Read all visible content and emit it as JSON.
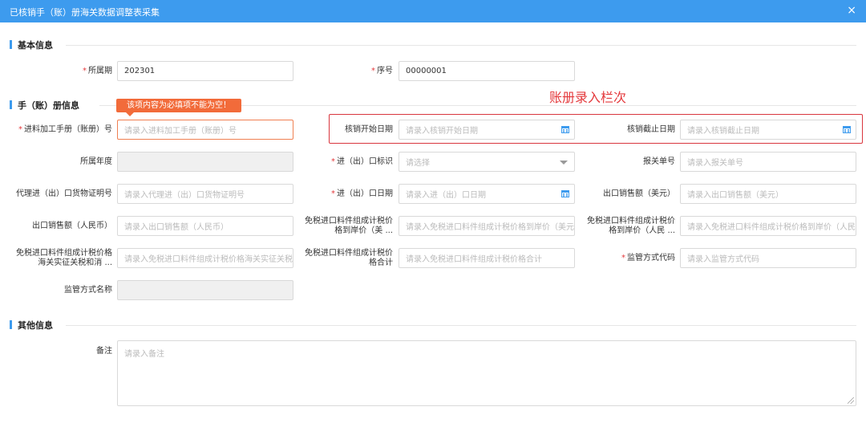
{
  "window": {
    "title": "已核销手（账）册海关数据调整表采集",
    "close_glyph": "×"
  },
  "sections": {
    "basic": "基本信息",
    "manual": "手（账）册信息",
    "other": "其他信息"
  },
  "fields": {
    "period": {
      "label": "所属期",
      "required": true,
      "value": "202301"
    },
    "seq": {
      "label": "序号",
      "required": true,
      "value": "00000001"
    },
    "manual_no": {
      "label": "进料加工手册（账册）号",
      "required": true,
      "placeholder": "请录入进料加工手册（账册）号"
    },
    "start_date": {
      "label": "核销开始日期",
      "placeholder": "请录入核销开始日期"
    },
    "end_date": {
      "label": "核销截止日期",
      "placeholder": "请录入核销截止日期"
    },
    "year": {
      "label": "所属年度"
    },
    "io_flag": {
      "label": "进（出）口标识",
      "required": true,
      "placeholder": "请选择"
    },
    "declare_no": {
      "label": "报关单号",
      "placeholder": "请录入报关单号"
    },
    "agent_cert": {
      "label": "代理进（出）口货物证明号",
      "placeholder": "请录入代理进（出）口货物证明号"
    },
    "io_date": {
      "label": "进（出）口日期",
      "required": true,
      "placeholder": "请录入进（出）口日期"
    },
    "export_usd": {
      "label": "出口销售额（美元）",
      "placeholder": "请录入出口销售额（美元）"
    },
    "export_cny": {
      "label": "出口销售额（人民币）",
      "placeholder": "请录入出口销售额（人民币）"
    },
    "dutyfree_usd": {
      "label": "免税进口料件组成计税价格到岸价（美 ...",
      "placeholder": "请录入免税进口料件组成计税价格到岸价（美元"
    },
    "dutyfree_cny": {
      "label": "免税进口料件组成计税价格到岸价（人民 ...",
      "placeholder": "请录入免税进口料件组成计税价格到岸价（人民"
    },
    "dutyfree_customs": {
      "label": "免税进口料件组成计税价格海关实征关税和消 ...",
      "placeholder": "请录入免税进口料件组成计税价格海关实征关税"
    },
    "dutyfree_total": {
      "label": "免税进口料件组成计税价格合计",
      "placeholder": "请录入免税进口料件组成计税价格合计"
    },
    "supervise_code": {
      "label": "监管方式代码",
      "required": true,
      "placeholder": "请录入监管方式代码"
    },
    "supervise_name": {
      "label": "监管方式名称"
    },
    "remark": {
      "label": "备注",
      "placeholder": "请录入备注"
    }
  },
  "validation": {
    "message": "该项内容为必填项不能为空！"
  },
  "annotation": {
    "text": "账册录入栏次",
    "color": "#e4393c"
  },
  "colors": {
    "header": "#3d9bee",
    "required": "#e4393c",
    "tooltip": "#f26b3a"
  }
}
